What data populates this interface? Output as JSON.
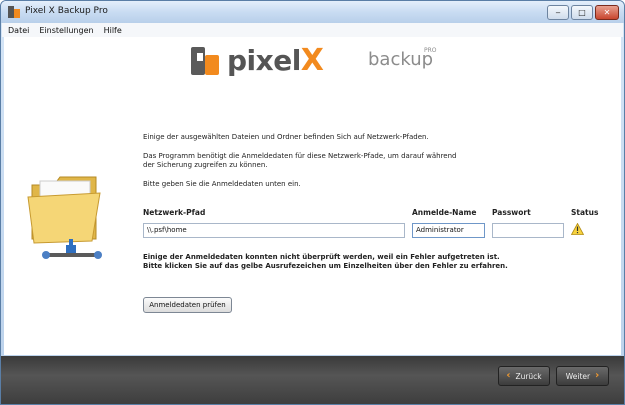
{
  "window": {
    "title": "Pixel X Backup Pro",
    "controls": {
      "minimize": "‒",
      "maximize": "□",
      "close": "✕"
    }
  },
  "menu": {
    "items": [
      "Datei",
      "Einstellungen",
      "Hilfe"
    ]
  },
  "logo": {
    "brand_main": "pixel",
    "brand_x": "X",
    "product": "backup",
    "edition": "PRO",
    "accent_color": "#f28a1e"
  },
  "intro": {
    "line1": "Einige der ausgewählten Dateien und Ordner befinden Sich auf Netzwerk-Pfaden.",
    "line2a": "Das Programm benötigt die Anmeldedaten für diese Netzwerk-Pfade, um darauf während",
    "line2b": "der Sicherung zugreifen zu können.",
    "line3": "Bitte geben Sie die Anmeldedaten unten ein."
  },
  "table": {
    "headers": {
      "path": "Netzwerk-Pfad",
      "login": "Anmelde-Name",
      "password": "Passwort",
      "status": "Status"
    },
    "row": {
      "path": "\\\\.psf\\home",
      "login": "Administrator",
      "password": "",
      "status_icon": "warning-icon"
    }
  },
  "error": {
    "line1": "Einige der Anmeldedaten konnten nicht überprüft werden, weil ein Fehler aufgetreten ist.",
    "line2": "Bitte klicken Sie auf das gelbe Ausrufezeichen um Einzelheiten über den Fehler zu erfahren."
  },
  "buttons": {
    "check": "Anmeldedaten prüfen",
    "back": "Zurück",
    "next": "Weiter"
  }
}
